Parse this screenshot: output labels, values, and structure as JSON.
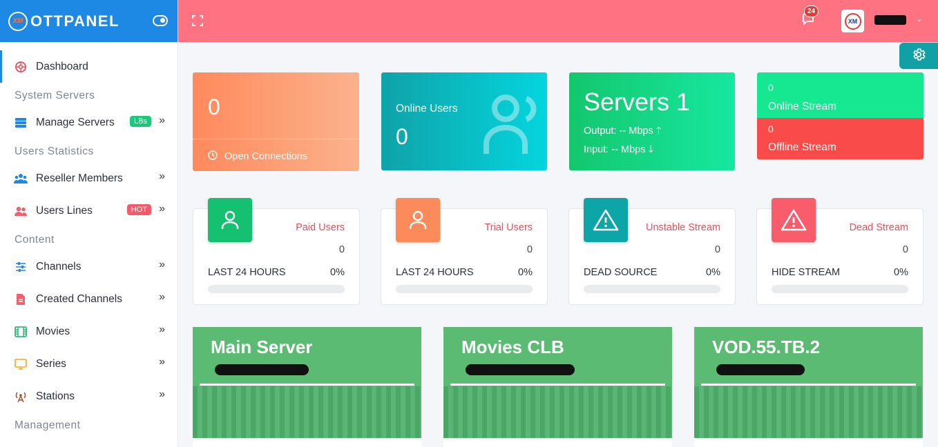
{
  "brand": {
    "logo_mark": "XM",
    "name": "OTTPANEL"
  },
  "sidebar": {
    "items": [
      {
        "label": "Dashboard",
        "icon": "dashboard-icon",
        "active": true
      },
      {
        "section": "System Servers"
      },
      {
        "label": "Manage Servers",
        "icon": "servers-icon",
        "badge": "LBs",
        "badge_color": "#1ec77a"
      },
      {
        "section": "Users Statistics"
      },
      {
        "label": "Reseller Members",
        "icon": "users-group-icon"
      },
      {
        "label": "Users Lines",
        "icon": "users-icon",
        "badge": "HOT",
        "badge_color": "#f25c6a"
      },
      {
        "section": "Content"
      },
      {
        "label": "Channels",
        "icon": "sliders-icon"
      },
      {
        "label": "Created Channels",
        "icon": "file-icon"
      },
      {
        "label": "Movies",
        "icon": "film-icon"
      },
      {
        "label": "Series",
        "icon": "monitor-icon"
      },
      {
        "label": "Stations",
        "icon": "broadcast-icon"
      },
      {
        "section": "Management"
      }
    ]
  },
  "topbar": {
    "notification_count": "24",
    "avatar_mark": "XM"
  },
  "cards": {
    "open_connections": {
      "value": "0",
      "label": "Open Connections"
    },
    "online_users": {
      "label": "Online Users",
      "value": "0"
    },
    "servers": {
      "title": "Servers 1",
      "output": "Output: -- Mbps",
      "input": "Input: -- Mbps"
    },
    "online_stream": {
      "value": "0",
      "label": "Online Stream"
    },
    "offline_stream": {
      "value": "0",
      "label": "Offline Stream"
    }
  },
  "stats": [
    {
      "title": "Paid Users",
      "count": "0",
      "foot_label": "LAST 24 HOURS",
      "foot_value": "0%",
      "progress": 0,
      "icon": "user-icon",
      "color": "#15c070"
    },
    {
      "title": "Trial Users",
      "count": "0",
      "foot_label": "LAST 24 HOURS",
      "foot_value": "0%",
      "progress": 0,
      "icon": "user-icon",
      "color": "#fc8a5a"
    },
    {
      "title": "Unstable Stream",
      "count": "0",
      "foot_label": "DEAD SOURCE",
      "foot_value": "0%",
      "progress": 0,
      "icon": "warning-icon",
      "color": "#0ea5a9"
    },
    {
      "title": "Dead Stream",
      "count": "0",
      "foot_label": "HIDE STREAM",
      "foot_value": "0%",
      "progress": 0,
      "icon": "warning-icon",
      "color": "#f95d6c"
    }
  ],
  "servers": [
    {
      "name": "Main Server"
    },
    {
      "name": "Movies CLB"
    },
    {
      "name": "VOD.55.TB.2"
    }
  ]
}
